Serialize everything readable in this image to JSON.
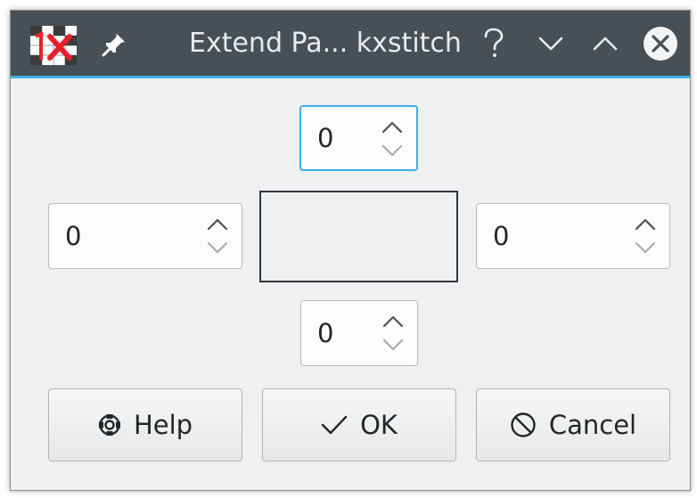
{
  "window": {
    "title": "Extend Pa... kxstitch"
  },
  "titlebar": {
    "icons": [
      "kxstitch-app-icon",
      "pin-icon",
      "help-icon",
      "minimize-icon",
      "maximize-icon",
      "close-icon"
    ]
  },
  "spinboxes": {
    "top": "0",
    "left": "0",
    "right": "0",
    "bottom": "0"
  },
  "buttons": {
    "help": "Help",
    "ok": "OK",
    "cancel": "Cancel"
  },
  "colors": {
    "titlebar": "#475057",
    "accent": "#3daee9",
    "background": "#eff0f1"
  }
}
